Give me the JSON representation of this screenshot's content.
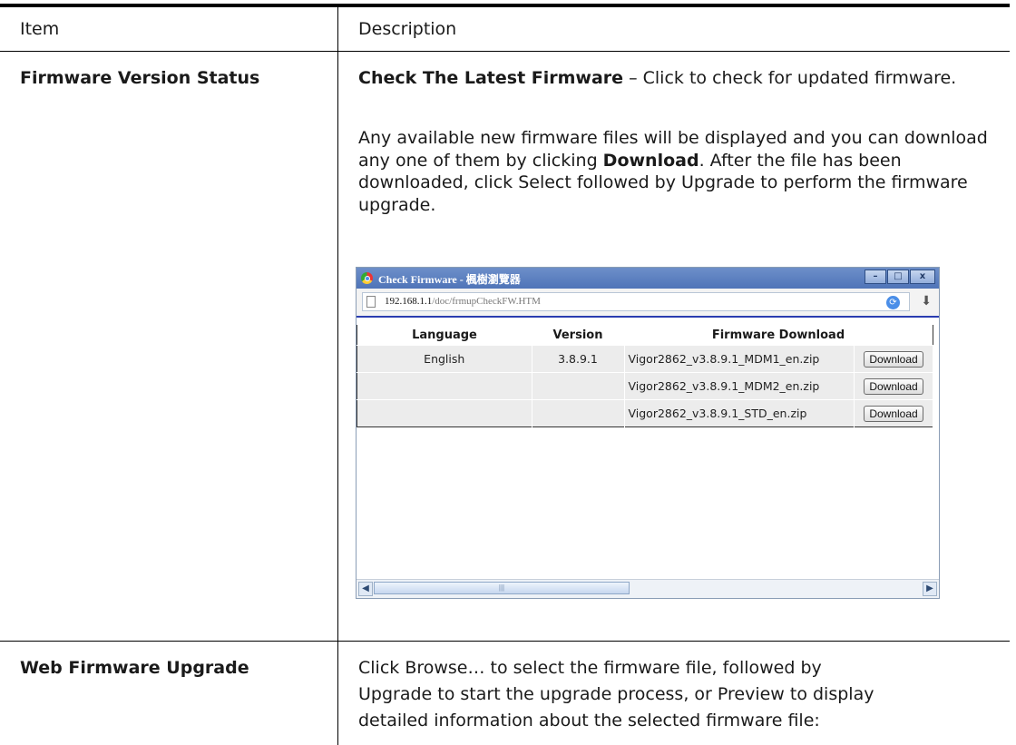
{
  "table": {
    "header": {
      "item": "Item",
      "description": "Description"
    },
    "rows": [
      {
        "item": "Firmware Version Status",
        "p1_bold": "Check The Latest Firmware",
        "p1_rest": " – Click to check for updated firmware.",
        "p2_a": "Any available new firmware files will be displayed and you can download any one of them by clicking ",
        "p2_b": "Download",
        "p2_c": ". After the file has been downloaded, click Select followed by Upgrade to perform the firmware upgrade."
      },
      {
        "item": "Web Firmware Upgrade",
        "line1": "Click Browse… to select the firmware file, followed by",
        "line2": "Upgrade to start the upgrade process, or Preview to display",
        "line3": "detailed information about the selected firmware file:"
      }
    ]
  },
  "popup": {
    "title": "Check Firmware - 楓樹瀏覽器",
    "address_host": "192.168.1.1",
    "address_path": "/doc/frmupCheckFW.HTM",
    "columns": [
      "Language",
      "Version",
      "Firmware Download"
    ],
    "rows": [
      {
        "language": "English",
        "version": "3.8.9.1",
        "file": "Vigor2862_v3.8.9.1_MDM1_en.zip",
        "button": "Download"
      },
      {
        "language": "",
        "version": "",
        "file": "Vigor2862_v3.8.9.1_MDM2_en.zip",
        "button": "Download"
      },
      {
        "language": "",
        "version": "",
        "file": "Vigor2862_v3.8.9.1_STD_en.zip",
        "button": "Download"
      }
    ]
  }
}
